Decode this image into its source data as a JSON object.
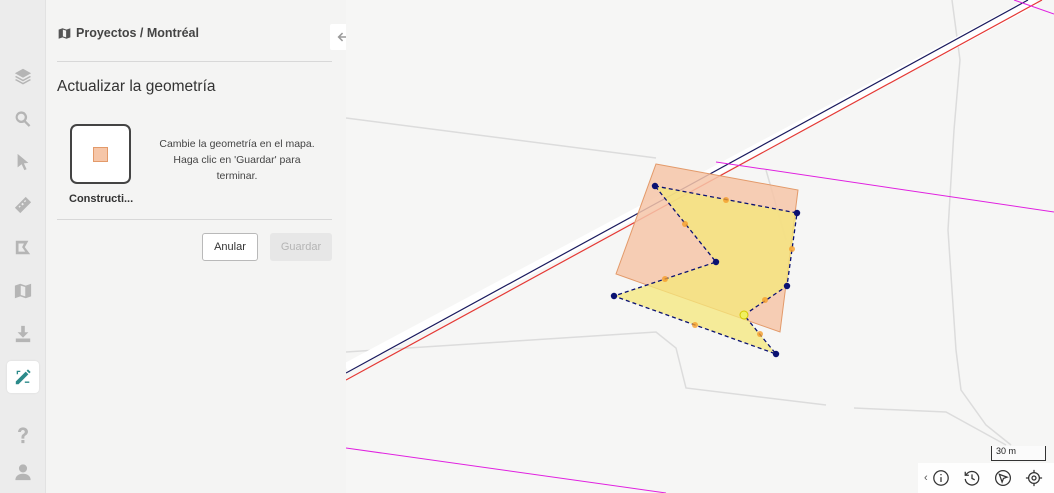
{
  "rail": {
    "items": [
      {
        "name": "layers-icon",
        "active": false
      },
      {
        "name": "search-icon",
        "active": false
      },
      {
        "name": "select-cursor-icon",
        "active": false
      },
      {
        "name": "measure-ruler-icon",
        "active": false
      },
      {
        "name": "draw-shape-icon",
        "active": false
      },
      {
        "name": "map-icon",
        "active": false
      },
      {
        "name": "download-icon",
        "active": false
      },
      {
        "name": "edit-tools-icon",
        "active": true
      },
      {
        "name": "help-icon",
        "active": false
      },
      {
        "name": "user-icon",
        "active": false
      }
    ]
  },
  "panel": {
    "breadcrumb": "Proyectos / Montréal",
    "title": "Actualizar la geometría",
    "layer_name": "Constructi...",
    "instructions": "Cambie la geometría en el mapa. Haga clic en 'Guardar' para terminar.",
    "cancel_label": "Anular",
    "save_label": "Guardar"
  },
  "map": {
    "scale_label": "30 m",
    "colors": {
      "building_fill": "#f6c6a8",
      "building_stroke": "#e39a6a",
      "edit_fill": "#f4e77a",
      "vertex": "#0a1172",
      "road_red": "#e53935",
      "road_navy": "#1a1a5e",
      "boundary_magenta": "#e020e0"
    },
    "tools": [
      "info-icon",
      "history-icon",
      "navigation-icon",
      "locate-icon"
    ]
  }
}
